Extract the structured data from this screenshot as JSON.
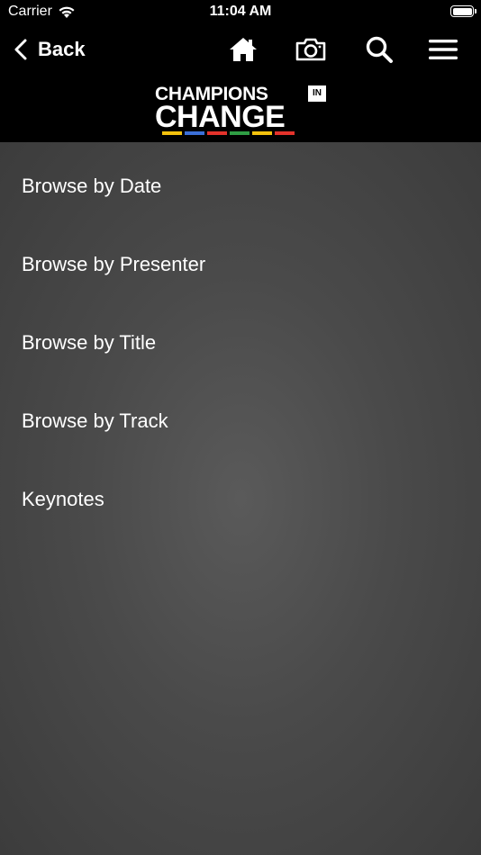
{
  "status_bar": {
    "carrier": "Carrier",
    "time": "11:04 AM"
  },
  "nav": {
    "back_label": "Back",
    "icons": [
      "home-icon",
      "camera-icon",
      "search-icon",
      "menu-icon"
    ]
  },
  "logo": {
    "line1": "CHAMPIONS",
    "badge": "IN",
    "line2": "CHANGE",
    "stripe_colors": [
      "#f4c20d",
      "#3b6fd8",
      "#e4322b",
      "#2f9e44",
      "#f4c20d",
      "#e4322b"
    ]
  },
  "menu": {
    "items": [
      {
        "label": "Browse by Date"
      },
      {
        "label": "Browse by Presenter"
      },
      {
        "label": "Browse by Title"
      },
      {
        "label": "Browse by Track"
      },
      {
        "label": "Keynotes"
      }
    ]
  },
  "colors": {
    "bar_background": "#000000",
    "content_background": "#4a4a4a",
    "text": "#ffffff"
  }
}
